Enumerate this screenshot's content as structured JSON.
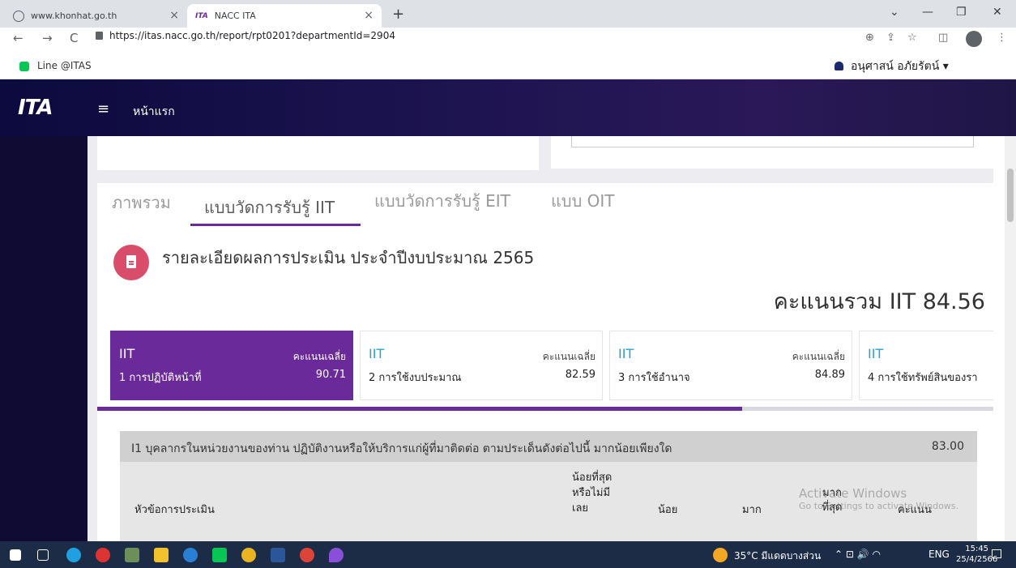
{
  "browser": {
    "tabs": [
      {
        "title": "www.khonhat.go.th",
        "active": false
      },
      {
        "title": "NACC ITA",
        "active": true
      }
    ],
    "new_tab": "+",
    "url": "https://itas.nacc.go.th/report/rpt0201?departmentId=2904",
    "bookmark": "Line @ITAS",
    "window_controls": {
      "minimize": "—",
      "restore": "❐",
      "close": "✕",
      "tabsearch": "⌄"
    },
    "nav": {
      "back": "←",
      "forward": "→",
      "reload": "C"
    },
    "toolbar_icons": {
      "zoom": "⊕",
      "share": "⇪",
      "star": "☆",
      "sidebar": "◫",
      "menu": "⋮"
    }
  },
  "app": {
    "logo": "ITA",
    "menu_icon": "≡",
    "home_link": "หน้าแรก",
    "user_name": "อนุศาสน์ อภัยรัตน์ ▾",
    "colors": {
      "header": "#1d1450",
      "accent": "#6a2a9a",
      "icon_circle": "#d94d6a",
      "code_blue": "#2aa3c8"
    }
  },
  "tabs": [
    {
      "label": "ภาพรวม",
      "active": false
    },
    {
      "label": "แบบวัดการรับรู้ IIT",
      "active": true
    },
    {
      "label": "แบบวัดการรับรู้ EIT",
      "active": false
    },
    {
      "label": "แบบ OIT",
      "active": false
    }
  ],
  "report": {
    "title": "รายละเอียดผลการประเมิน ประจำปีงบประมาณ 2565",
    "total_score": "คะแนนรวม IIT 84.56"
  },
  "score_cards": [
    {
      "code": "IIT",
      "avg_label": "คะแนนเฉลี่ย",
      "name": "1 การปฏิบัติหน้าที่",
      "value": "90.71",
      "active": true
    },
    {
      "code": "IIT",
      "avg_label": "คะแนนเฉลี่ย",
      "name": "2 การใช้งบประมาณ",
      "value": "82.59",
      "active": false
    },
    {
      "code": "IIT",
      "avg_label": "คะแนนเฉลี่ย",
      "name": "3 การใช้อำนาจ",
      "value": "84.89",
      "active": false
    },
    {
      "code": "IIT",
      "avg_label": "คะแนนเฉลี่ย",
      "name": "4 การใช้ทรัพย์สินของรา",
      "value": "",
      "active": false
    }
  ],
  "carousel_progress": 0.72,
  "question": {
    "text": "I1 บุคลากรในหน่วยงานของท่าน ปฏิบัติงานหรือให้บริการแก่ผู้ที่มาติดต่อ ตามประเด็นดังต่อไปนี้ มากน้อยเพียงใด",
    "score": "83.00",
    "columns": [
      "หัวข้อการประเมิน",
      "น้อยที่สุด หรือไม่มี เลย",
      "น้อย",
      "มาก",
      "มาก ที่สุด",
      "คะแนน"
    ]
  },
  "watermark": {
    "line1": "Activate Windows",
    "line2": "Go to Settings to activate Windows."
  },
  "taskbar": {
    "weather": "35°C มีแดดบางส่วน",
    "tray_icons": "⌃ ⊡ 🔊 ◠",
    "lang": "ENG",
    "time": "15:45",
    "date": "25/4/2566"
  }
}
